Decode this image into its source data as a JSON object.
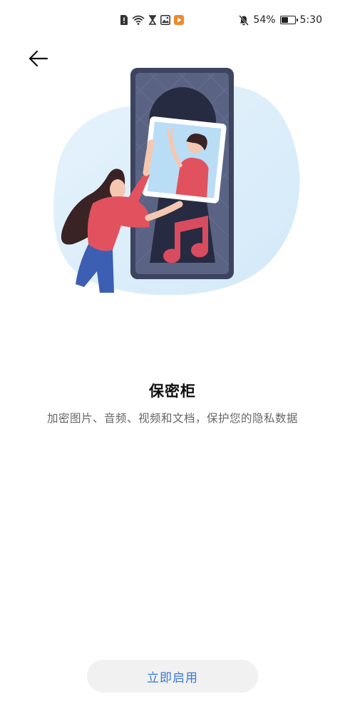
{
  "status_bar": {
    "battery_percent": "54%",
    "battery_level": 0.54,
    "time": "5:30",
    "icons": [
      "alert-icon",
      "wifi-icon",
      "hourglass-icon",
      "image-icon",
      "play-icon",
      "mute-icon",
      "battery-icon"
    ]
  },
  "header": {
    "back_icon": "arrow-left-icon"
  },
  "feature": {
    "title": "保密柜",
    "description": "加密图片、音频、视频和文档，保护您的隐私数据"
  },
  "actions": {
    "enable_label": "立即启用"
  },
  "colors": {
    "accent": "#3a7bd5",
    "button_bg": "#f1f1f1",
    "phone_frame": "#3d4460",
    "blob": "#dbeefa",
    "music_note": "#d94b5e",
    "shirt": "#e2525e"
  }
}
